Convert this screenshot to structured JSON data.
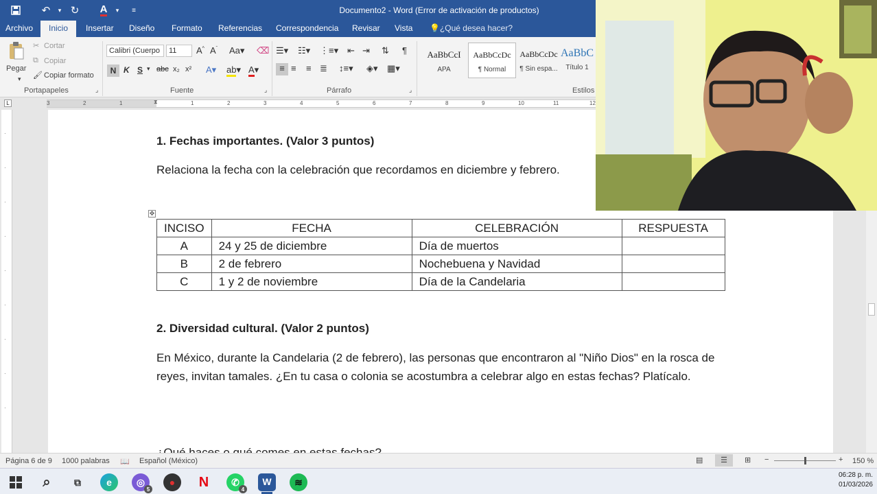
{
  "window": {
    "title": "Documento2 - Word (Error de activación de productos)"
  },
  "tabs": [
    {
      "label": "Archivo"
    },
    {
      "label": "Inicio"
    },
    {
      "label": "Insertar"
    },
    {
      "label": "Diseño"
    },
    {
      "label": "Formato"
    },
    {
      "label": "Referencias"
    },
    {
      "label": "Correspondencia"
    },
    {
      "label": "Revisar"
    },
    {
      "label": "Vista"
    }
  ],
  "tell_me": "¿Qué desea hacer?",
  "ribbon": {
    "clipboard": {
      "paste": "Pegar",
      "cut": "Cortar",
      "copy": "Copiar",
      "format_painter": "Copiar formato",
      "label": "Portapapeles"
    },
    "font": {
      "font_name": "Calibri (Cuerpo",
      "font_size": "11",
      "label": "Fuente",
      "bold": "N",
      "italic": "K",
      "underline": "S"
    },
    "paragraph": {
      "label": "Párrafo"
    },
    "styles": {
      "label": "Estilos",
      "items": [
        {
          "sample": "AaBbCcI",
          "name": "APA"
        },
        {
          "sample": "AaBbCcDc",
          "name": "¶ Normal"
        },
        {
          "sample": "AaBbCcDc",
          "name": "¶ Sin espa..."
        },
        {
          "sample": "AaBbC",
          "name": "Título 1"
        }
      ]
    }
  },
  "ruler": {
    "marks": [
      "3",
      "2",
      "1",
      "1",
      "2",
      "3",
      "4",
      "5",
      "6",
      "7",
      "8",
      "9",
      "10",
      "11",
      "12"
    ]
  },
  "document": {
    "section1": {
      "heading": "1. Fechas importantes. (Valor 3 puntos)",
      "instruction": "Relaciona la fecha con la celebración que recordamos en diciembre y febrero."
    },
    "table": {
      "headers": [
        "INCISO",
        "FECHA",
        "CELEBRACIÓN",
        "RESPUESTA"
      ],
      "rows": [
        [
          "A",
          "24 y 25 de diciembre",
          "Día de muertos",
          ""
        ],
        [
          "B",
          "2 de febrero",
          "Nochebuena y Navidad",
          ""
        ],
        [
          "C",
          "1 y 2 de noviembre",
          "Día de la Candelaria",
          ""
        ]
      ]
    },
    "section2": {
      "heading": "2. Diversidad cultural. (Valor 2 puntos)",
      "paragraph": "En México, durante la Candelaria (2 de febrero), las personas que encontraron al \"Niño Dios\" en la rosca de reyes, invitan tamales. ¿En tu casa o colonia se acostumbra a celebrar algo en estas fechas? Platícalo.",
      "question": "¿Qué haces o qué comes en estas fechas?"
    }
  },
  "statusbar": {
    "page": "Página 6 de 9",
    "words": "1000 palabras",
    "language": "Español (México)",
    "zoom": "150 %"
  },
  "taskbar": {
    "badges": {
      "discord": "5",
      "whatsapp": "4"
    },
    "time": "06:28 p. m.",
    "date": "01/03/2026"
  }
}
